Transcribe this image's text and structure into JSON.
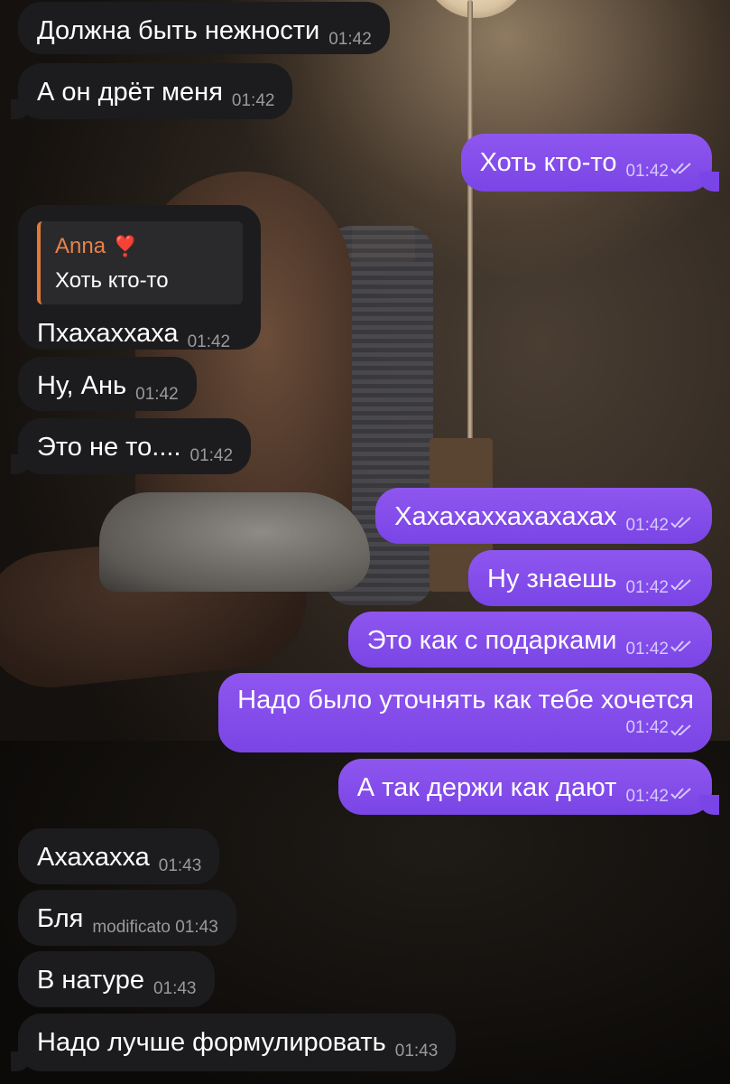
{
  "messages": [
    {
      "text": "Должна быть нежности",
      "time": "01:42"
    },
    {
      "text": "А он дрёт меня",
      "time": "01:42"
    },
    {
      "text": "Хоть кто-то",
      "time": "01:42"
    },
    {
      "reply": {
        "name": "Anna",
        "heart": "❣️",
        "text": "Хоть кто-то"
      },
      "text": "Пхахаххаха",
      "time": "01:42"
    },
    {
      "text": "Ну, Ань",
      "time": "01:42"
    },
    {
      "text": "Это не то....",
      "time": "01:42"
    },
    {
      "text": "Хахахаххахахахах",
      "time": "01:42"
    },
    {
      "text": "Ну знаешь",
      "time": "01:42"
    },
    {
      "text": "Это как с подарками",
      "time": "01:42"
    },
    {
      "text": "Надо было уточнять как тебе хочется",
      "time": "01:42"
    },
    {
      "text": "А так держи как дают",
      "time": "01:42"
    },
    {
      "text": "Ахахахха",
      "time": "01:43"
    },
    {
      "text": "Бля",
      "edited": "modificato",
      "time": "01:43"
    },
    {
      "text": "В натуре",
      "time": "01:43"
    },
    {
      "text": "Надо лучше формулировать",
      "time": "01:43"
    }
  ],
  "colors": {
    "incoming": "#1c1c1e",
    "outgoing": "#8a52ee",
    "reply_accent": "#e07a3a"
  },
  "icons": {
    "read": "double-check-icon"
  }
}
